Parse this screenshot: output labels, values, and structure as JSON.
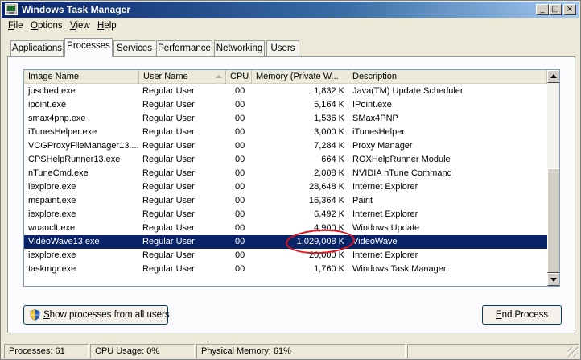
{
  "window": {
    "title": "Windows Task Manager",
    "min_glyph": "_",
    "max_glyph": "□",
    "close_glyph": "×"
  },
  "menu": [
    {
      "ul": "F",
      "rest": "ile"
    },
    {
      "ul": "O",
      "rest": "ptions"
    },
    {
      "ul": "V",
      "rest": "iew"
    },
    {
      "ul": "H",
      "rest": "elp"
    }
  ],
  "tabs": [
    "Applications",
    "Processes",
    "Services",
    "Performance",
    "Networking",
    "Users"
  ],
  "active_tab": "Processes",
  "columns": [
    "Image Name",
    "User Name",
    "CPU",
    "Memory (Private W...",
    "Description"
  ],
  "sorted_column": "User Name",
  "processes": [
    {
      "name": "jusched.exe",
      "user": "Regular User",
      "cpu": "00",
      "mem": "1,832 K",
      "desc": "Java(TM) Update Scheduler"
    },
    {
      "name": "ipoint.exe",
      "user": "Regular User",
      "cpu": "00",
      "mem": "5,164 K",
      "desc": "IPoint.exe"
    },
    {
      "name": "smax4pnp.exe",
      "user": "Regular User",
      "cpu": "00",
      "mem": "1,536 K",
      "desc": "SMax4PNP"
    },
    {
      "name": "iTunesHelper.exe",
      "user": "Regular User",
      "cpu": "00",
      "mem": "3,000 K",
      "desc": "iTunesHelper"
    },
    {
      "name": "VCGProxyFileManager13....",
      "user": "Regular User",
      "cpu": "00",
      "mem": "7,284 K",
      "desc": "Proxy Manager"
    },
    {
      "name": "CPSHelpRunner13.exe",
      "user": "Regular User",
      "cpu": "00",
      "mem": "664 K",
      "desc": "ROXHelpRunner Module"
    },
    {
      "name": "nTuneCmd.exe",
      "user": "Regular User",
      "cpu": "00",
      "mem": "2,008 K",
      "desc": "NVIDIA nTune Command"
    },
    {
      "name": "iexplore.exe",
      "user": "Regular User",
      "cpu": "00",
      "mem": "28,648 K",
      "desc": "Internet Explorer"
    },
    {
      "name": "mspaint.exe",
      "user": "Regular User",
      "cpu": "00",
      "mem": "16,364 K",
      "desc": "Paint"
    },
    {
      "name": "iexplore.exe",
      "user": "Regular User",
      "cpu": "00",
      "mem": "6,492 K",
      "desc": "Internet Explorer"
    },
    {
      "name": "wuauclt.exe",
      "user": "Regular User",
      "cpu": "00",
      "mem": "4,900 K",
      "desc": "Windows Update"
    },
    {
      "name": "VideoWave13.exe",
      "user": "Regular User",
      "cpu": "00",
      "mem": "1,029,008 K",
      "desc": "VideoWave",
      "selected": true
    },
    {
      "name": "iexplore.exe",
      "user": "Regular User",
      "cpu": "00",
      "mem": "20,000 K",
      "desc": "Internet Explorer"
    },
    {
      "name": "taskmgr.exe",
      "user": "Regular User",
      "cpu": "00",
      "mem": "1,760 K",
      "desc": "Windows Task Manager"
    }
  ],
  "buttons": {
    "show_all_ul": "S",
    "show_all_rest": "how processes from all users",
    "end_ul": "E",
    "end_rest": "nd Process"
  },
  "status": {
    "processes": "Processes: 61",
    "cpu": "CPU Usage: 0%",
    "memory": "Physical Memory: 61%"
  },
  "colors": {
    "selection": "#0a246a",
    "annotation": "#e2141c",
    "title_gradient_start": "#0a246a"
  },
  "icons": [
    "task-manager-app-icon",
    "uac-shield-icon",
    "sort-ascending-icon",
    "scroll-up-icon",
    "scroll-down-icon",
    "resize-grip-icon"
  ]
}
